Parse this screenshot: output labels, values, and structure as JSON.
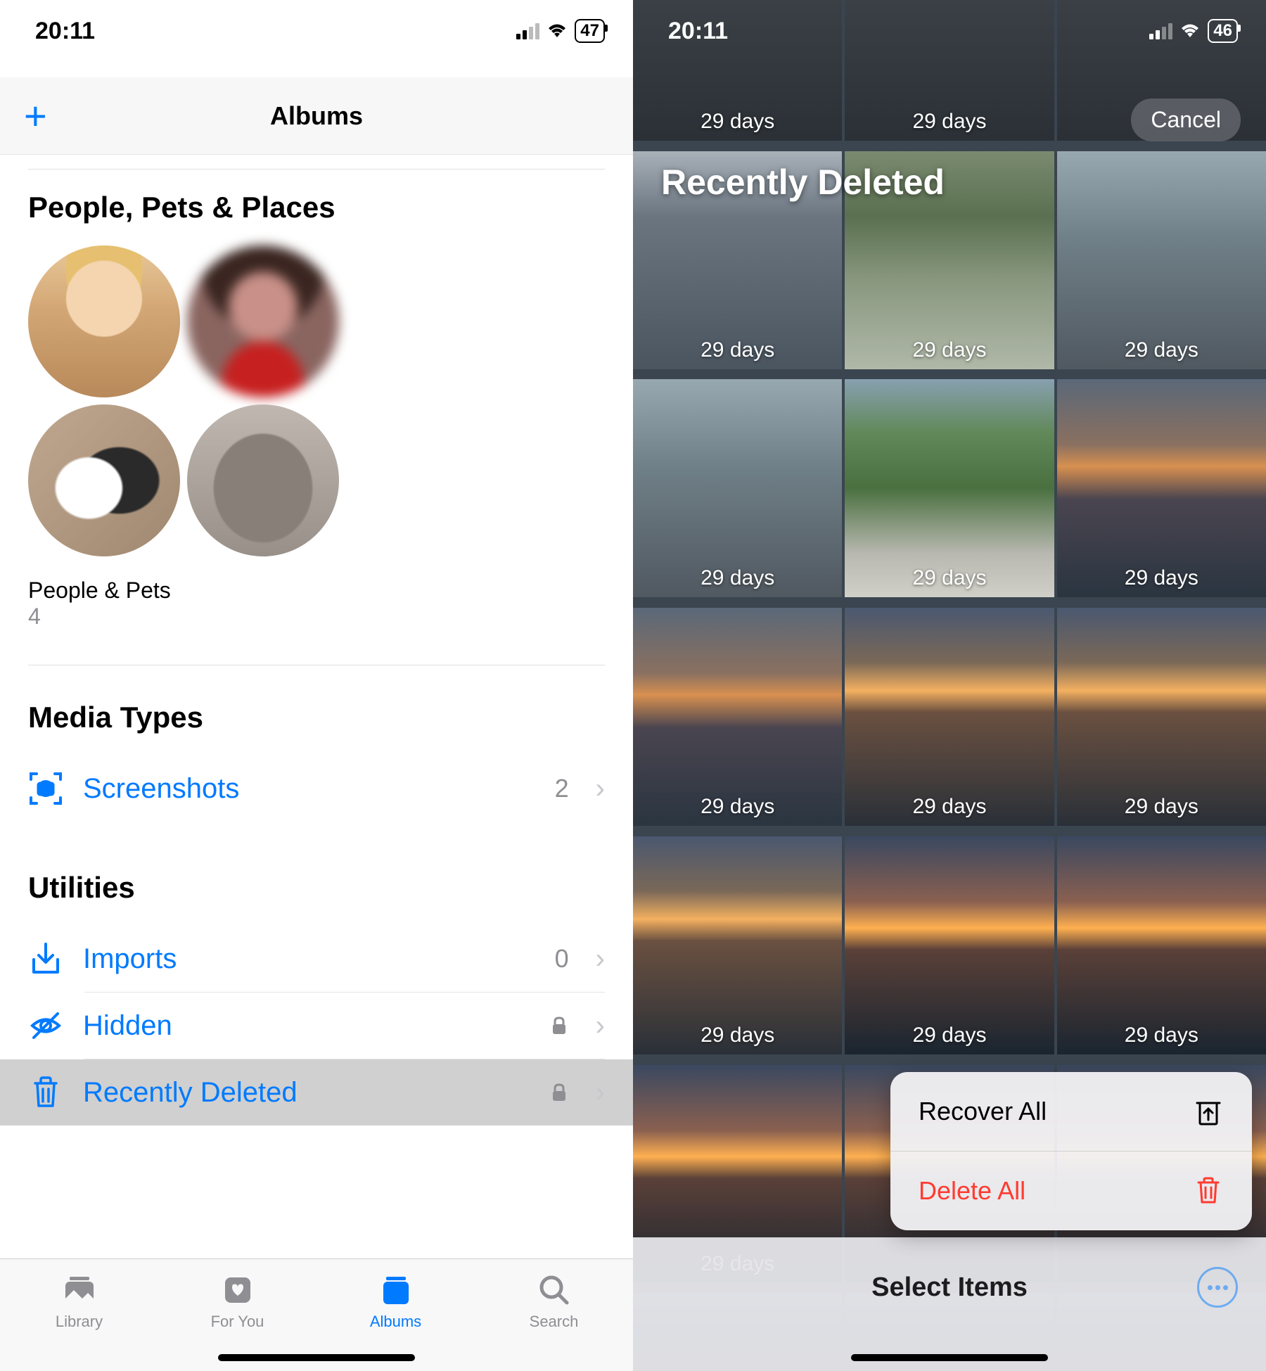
{
  "left": {
    "status": {
      "time": "20:11",
      "battery": "47"
    },
    "nav_title": "Albums",
    "sections": {
      "people": {
        "title": "People, Pets & Places",
        "album_label": "People & Pets",
        "album_count": "4"
      },
      "media_types": {
        "title": "Media Types",
        "rows": [
          {
            "label": "Screenshots",
            "count": "2"
          }
        ]
      },
      "utilities": {
        "title": "Utilities",
        "rows": [
          {
            "label": "Imports",
            "count": "0"
          },
          {
            "label": "Hidden"
          },
          {
            "label": "Recently Deleted"
          }
        ]
      }
    },
    "tabs": {
      "library": "Library",
      "for_you": "For You",
      "albums": "Albums",
      "search": "Search"
    }
  },
  "right": {
    "status": {
      "time": "20:11",
      "battery": "46"
    },
    "title": "Recently Deleted",
    "cancel": "Cancel",
    "days_label": "29 days",
    "actions": {
      "recover": "Recover All",
      "delete": "Delete All"
    },
    "toolbar": {
      "select_items": "Select Items"
    }
  }
}
